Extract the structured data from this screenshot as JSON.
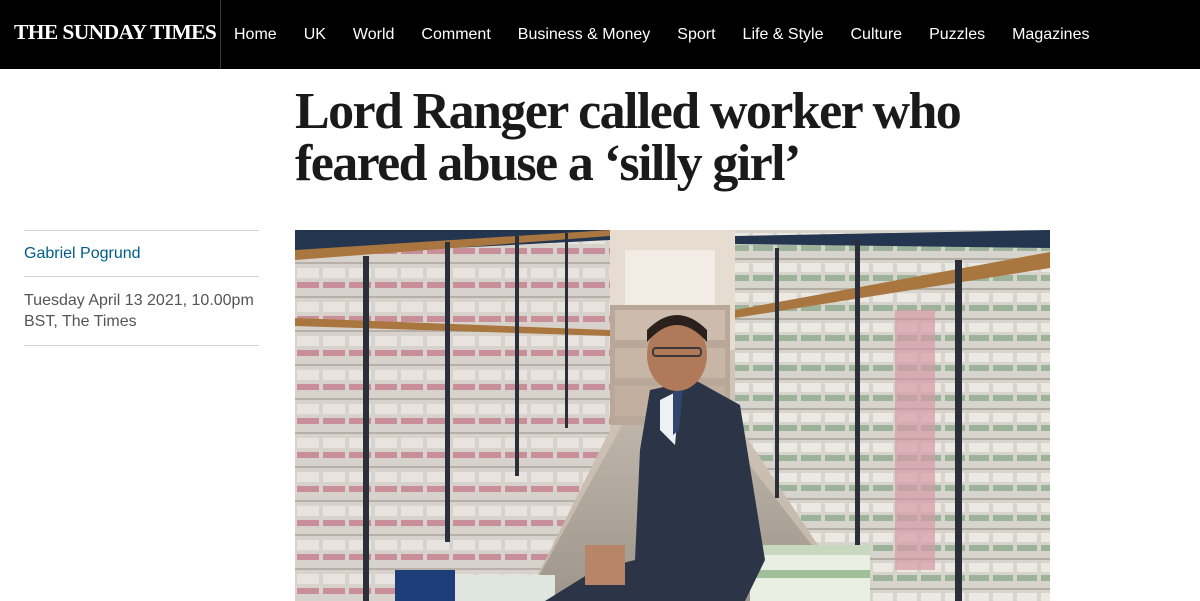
{
  "header": {
    "logo_text": "THE SUNDAY TIMES",
    "nav": [
      "Home",
      "UK",
      "World",
      "Comment",
      "Business & Money",
      "Sport",
      "Life & Style",
      "Culture",
      "Puzzles",
      "Magazines"
    ]
  },
  "article": {
    "headline": "Lord Ranger called worker who feared abuse a ‘silly girl’",
    "author": "Gabriel Pogrund",
    "dateline": "Tuesday April 13 2021, 10.00pm BST, The Times"
  },
  "colors": {
    "nav_background": "#000000",
    "author_link": "#005c8a"
  }
}
